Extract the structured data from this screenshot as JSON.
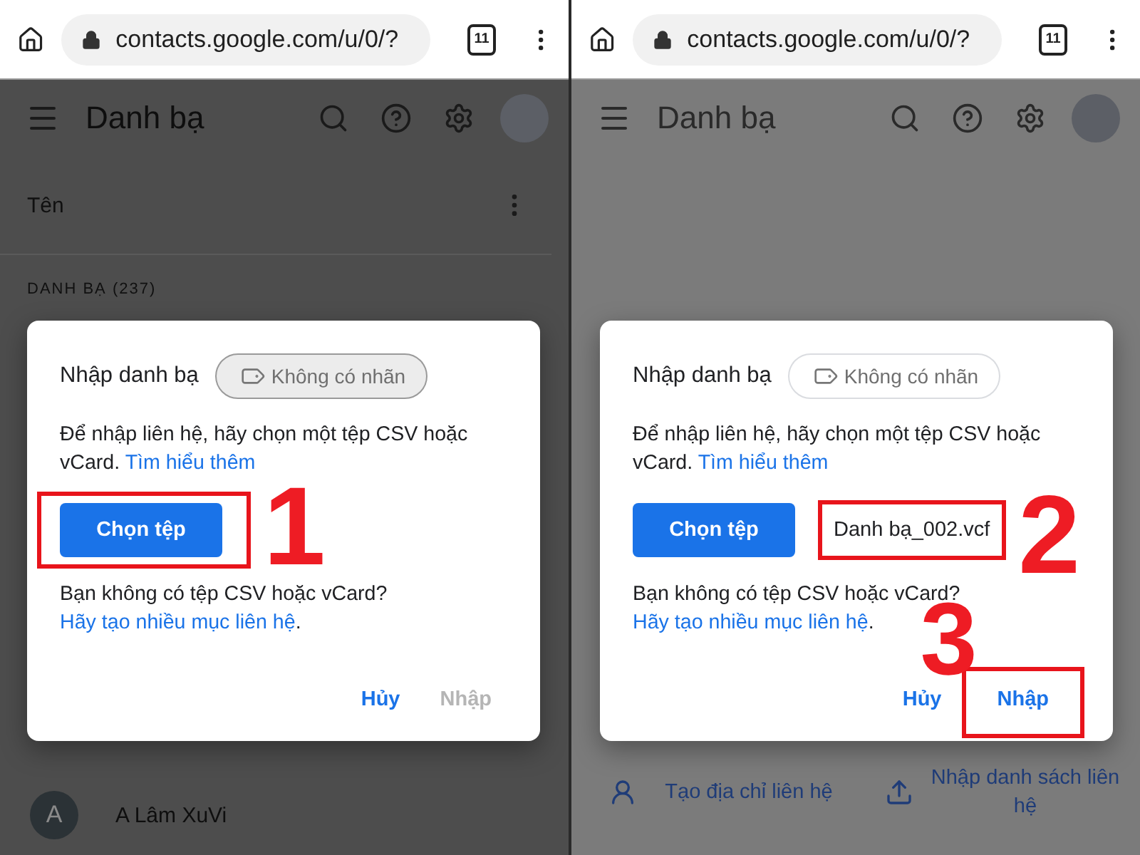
{
  "panels": [
    {
      "dark_overlay": true,
      "browser": {
        "url": "contacts.google.com/u/0/?",
        "tab_count": "11"
      },
      "app": {
        "title": "Danh bạ",
        "sort_label": "Tên",
        "section": "DANH BẠ (237)",
        "contacts": [
          {
            "initial": "A",
            "name": "A Lâm XuVi"
          }
        ]
      },
      "dialog": {
        "title": "Nhập danh bạ",
        "chip": {
          "text": "Không có nhãn",
          "highlighted": true
        },
        "intro": "Để nhập liên hệ, hãy chọn một tệp CSV hoặc vCard.",
        "intro_link": "Tìm hiểu thêm",
        "choose_button": {
          "label": "Chọn tệp",
          "step": "1"
        },
        "note": "Bạn không có tệp CSV hoặc vCard?",
        "note_link": "Hãy tạo nhiều mục liên hệ",
        "note_end": ".",
        "cancel": "Hủy",
        "import": {
          "label": "Nhập",
          "disabled": true
        }
      }
    },
    {
      "dark_overlay": false,
      "browser": {
        "url": "contacts.google.com/u/0/?",
        "tab_count": "11"
      },
      "app": {
        "title": "Danh bạ",
        "actions": [
          {
            "kind": "person",
            "label": "Tạo địa chỉ liên hệ"
          },
          {
            "kind": "upload",
            "label": "Nhập danh sách liên hệ"
          }
        ]
      },
      "dialog": {
        "title": "Nhập danh bạ",
        "chip": {
          "text": "Không có nhãn",
          "highlighted": false
        },
        "intro": "Để nhập liên hệ, hãy chọn một tệp CSV hoặc vCard.",
        "intro_link": "Tìm hiểu thêm",
        "choose_button": {
          "label": "Chọn tệp"
        },
        "file_name": {
          "text": "Danh bạ_002.vcf",
          "step": "2"
        },
        "note": "Bạn không có tệp CSV hoặc vCard?",
        "note_link": "Hãy tạo nhiều mục liên hệ",
        "note_end": ".",
        "cancel": "Hủy",
        "import": {
          "label": "Nhập",
          "disabled": false,
          "step": "3"
        }
      }
    }
  ]
}
